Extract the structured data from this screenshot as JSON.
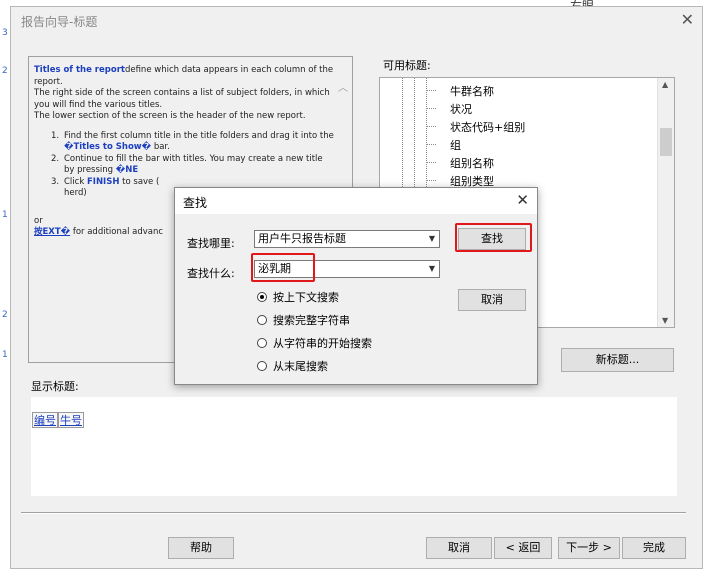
{
  "background": {
    "top_right_text": "右眼"
  },
  "dialog": {
    "title": "报告向导-标题",
    "close_glyph": "✕"
  },
  "help": {
    "p1_link": "Titles of the report",
    "p1_rest": "define which data appears in each column of the report.",
    "p2": "The right side of the screen contains a list of subject folders, in which you will find the various titles.",
    "p3": "The lower section of the screen is the header of the new report.",
    "steps": [
      {
        "n": "1.",
        "pre": "Find the first column title in the title folders and drag it into the ",
        "bold": "�Titles to Show�",
        "post": " bar."
      },
      {
        "n": "2.",
        "pre": "Continue to fill the bar with titles. You may create a new title by pressing ",
        "bold": "�NE",
        "post": ""
      },
      {
        "n": "3.",
        "pre": "Click ",
        "bold": "FINISH",
        "post": " to save ("
      }
    ],
    "step3_cont": "herd)",
    "or": "or",
    "ext_link": "按EXT�",
    "ext_rest": " for additional advanc"
  },
  "available": {
    "label": "可用标题:",
    "items": [
      "牛群名称",
      "状况",
      "状态代码+组别",
      "组",
      "组别名称",
      "组别类型"
    ]
  },
  "new_title_button": "新标题...",
  "shown": {
    "label": "显示标题:",
    "columns": [
      "编号",
      "牛号"
    ]
  },
  "bottom_buttons": {
    "help": "帮助",
    "cancel": "取消",
    "back": "< 返回",
    "next": "下一步 >",
    "finish": "完成"
  },
  "find_dialog": {
    "title": "查找",
    "close_glyph": "✕",
    "where_label": "查找哪里:",
    "where_value": "用户牛只报告标题",
    "what_label": "查找什么:",
    "what_value": "泌乳期",
    "find_button": "查找",
    "cancel_button": "取消",
    "options": [
      "按上下文搜索",
      "搜索完整字符串",
      "从字符串的开始搜索",
      "从末尾搜索"
    ],
    "selected_option": 0
  },
  "colors": {
    "highlight": "#e0181b",
    "link_blue": "#1c3fbf"
  }
}
